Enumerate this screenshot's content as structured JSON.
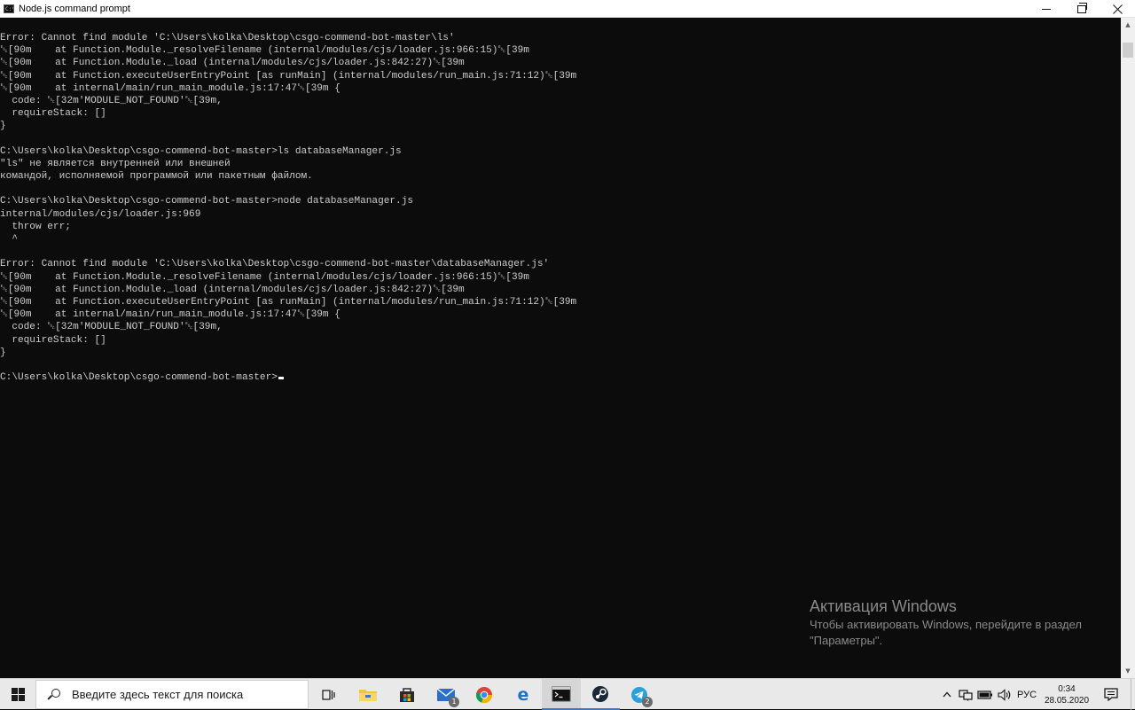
{
  "window": {
    "title": "Node.js command prompt",
    "icon_text": "C:\\"
  },
  "console": {
    "lines": [
      "Error: Cannot find module 'C:\\Users\\kolka\\Desktop\\csgo-commend-bot-master\\ls'",
      "␛[90m    at Function.Module._resolveFilename (internal/modules/cjs/loader.js:966:15)␛[39m",
      "␛[90m    at Function.Module._load (internal/modules/cjs/loader.js:842:27)␛[39m",
      "␛[90m    at Function.executeUserEntryPoint [as runMain] (internal/modules/run_main.js:71:12)␛[39m",
      "␛[90m    at internal/main/run_main_module.js:17:47␛[39m {",
      "  code: ␛[32m'MODULE_NOT_FOUND'␛[39m,",
      "  requireStack: []",
      "}",
      "",
      "C:\\Users\\kolka\\Desktop\\csgo-commend-bot-master>ls databaseManager.js",
      "\"ls\" не является внутренней или внешней",
      "командой, исполняемой программой или пакетным файлом.",
      "",
      "C:\\Users\\kolka\\Desktop\\csgo-commend-bot-master>node databaseManager.js",
      "internal/modules/cjs/loader.js:969",
      "  throw err;",
      "  ^",
      "",
      "Error: Cannot find module 'C:\\Users\\kolka\\Desktop\\csgo-commend-bot-master\\databaseManager.js'",
      "␛[90m    at Function.Module._resolveFilename (internal/modules/cjs/loader.js:966:15)␛[39m",
      "␛[90m    at Function.Module._load (internal/modules/cjs/loader.js:842:27)␛[39m",
      "␛[90m    at Function.executeUserEntryPoint [as runMain] (internal/modules/run_main.js:71:12)␛[39m",
      "␛[90m    at internal/main/run_main_module.js:17:47␛[39m {",
      "  code: ␛[32m'MODULE_NOT_FOUND'␛[39m,",
      "  requireStack: []",
      "}",
      "",
      "C:\\Users\\kolka\\Desktop\\csgo-commend-bot-master>"
    ],
    "text_color": "#cccccc",
    "background": "#0c0c0c"
  },
  "watermark": {
    "title": "Активация Windows",
    "line1": "Чтобы активировать Windows, перейдите в раздел",
    "line2": "\"Параметры\"."
  },
  "taskbar": {
    "search_placeholder": "Введите здесь текст для поиска",
    "apps": [
      {
        "name": "task-view",
        "icon": "task-view-icon"
      },
      {
        "name": "file-explorer",
        "icon": "folder-icon"
      },
      {
        "name": "microsoft-store",
        "icon": "store-icon"
      },
      {
        "name": "mail",
        "icon": "mail-icon",
        "badge": "1"
      },
      {
        "name": "chrome",
        "icon": "chrome-icon"
      },
      {
        "name": "edge",
        "icon": "edge-icon"
      },
      {
        "name": "node-command-prompt",
        "icon": "terminal-icon",
        "active": true
      },
      {
        "name": "steam",
        "icon": "steam-icon"
      },
      {
        "name": "telegram",
        "icon": "telegram-icon",
        "badge": "2"
      }
    ],
    "tray": {
      "language": "РУС",
      "time": "0:34",
      "date": "28.05.2020"
    },
    "accent_color": "#3a78c5"
  }
}
